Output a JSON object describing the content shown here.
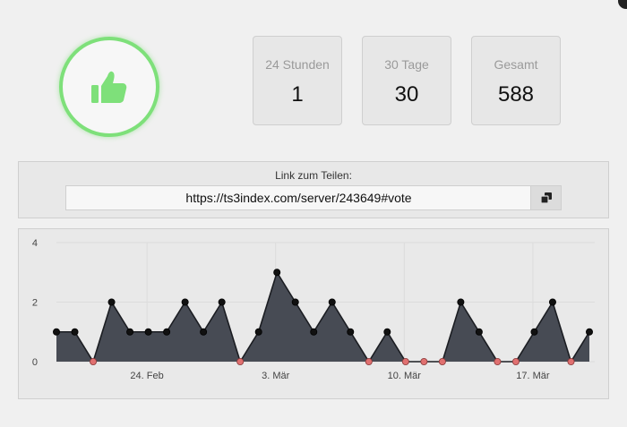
{
  "stats": [
    {
      "label": "24 Stunden",
      "value": "1"
    },
    {
      "label": "30 Tage",
      "value": "30"
    },
    {
      "label": "Gesamt",
      "value": "588"
    }
  ],
  "share": {
    "label": "Link zum Teilen:",
    "url": "https://ts3index.com/server/243649#vote"
  },
  "icons": {
    "vote": "thumbs-up-icon",
    "copy": "copy-icon",
    "close": "close-icon"
  },
  "colors": {
    "accent_green": "#7ee07a",
    "area_fill": "#474b54",
    "point_normal": "#111111",
    "point_zero": "#e07070"
  },
  "chart_data": {
    "type": "area",
    "values": [
      1,
      1,
      0,
      2,
      1,
      1,
      1,
      2,
      1,
      2,
      0,
      1,
      3,
      2,
      1,
      2,
      1,
      0,
      1,
      0,
      0,
      0,
      2,
      1,
      0,
      0,
      1,
      2,
      0,
      1
    ],
    "x_tick_labels": [
      "24. Feb",
      "3. Mär",
      "10. Mär",
      "17. Mär"
    ],
    "x_tick_index": [
      5,
      12,
      19,
      26
    ],
    "y_ticks": [
      0,
      2,
      4
    ],
    "ylim": [
      0,
      4
    ],
    "grid": true
  }
}
